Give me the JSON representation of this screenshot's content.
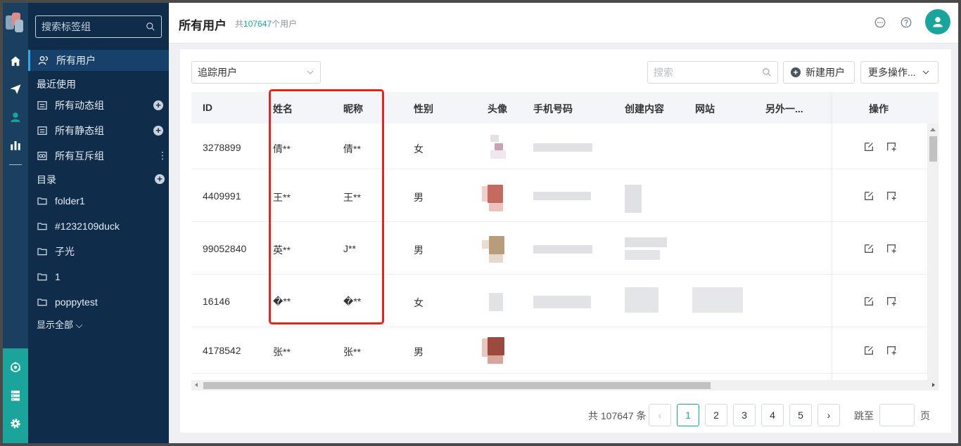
{
  "header": {
    "title": "所有用户",
    "count_prefix": "共",
    "count_value": "107647",
    "count_suffix": "个用户"
  },
  "sidebar": {
    "search_placeholder": "搜索标签组",
    "all_users": "所有用户",
    "recent_heading": "最近使用",
    "groups": [
      {
        "label": "所有动态组"
      },
      {
        "label": "所有静态组"
      },
      {
        "label": "所有互斥组"
      }
    ],
    "dir_heading": "目录",
    "folders": [
      {
        "label": "folder1"
      },
      {
        "label": "#1232109duck"
      },
      {
        "label": "子光"
      },
      {
        "label": "1"
      },
      {
        "label": "poppytest"
      }
    ],
    "show_all": "显示全部"
  },
  "toolbar": {
    "track_select": "追踪用户",
    "search_placeholder": "搜索",
    "new_user": "新建用户",
    "more_actions": "更多操作..."
  },
  "table": {
    "columns": [
      "ID",
      "姓名",
      "昵称",
      "性别",
      "头像",
      "手机号码",
      "创建内容",
      "网站",
      "另外一...",
      "操作"
    ],
    "rows": [
      {
        "id": "3278899",
        "name": "倩**",
        "nickname": "倩**",
        "gender": "女"
      },
      {
        "id": "4409991",
        "name": "王**",
        "nickname": "王**",
        "gender": "男"
      },
      {
        "id": "99052840",
        "name": "英**",
        "nickname": "J**",
        "gender": "男"
      },
      {
        "id": "16146",
        "name": "�**",
        "nickname": "�**",
        "gender": "女"
      },
      {
        "id": "4178542",
        "name": "张**",
        "nickname": "张**",
        "gender": "男"
      }
    ]
  },
  "pagination": {
    "total": "共 107647 条",
    "pages": [
      "1",
      "2",
      "3",
      "4",
      "5"
    ],
    "current": "1",
    "jump_label": "跳至",
    "page_label": "页"
  },
  "colors": {
    "accent": "#1aa49b",
    "sidebar_bg": "#0f2c4a",
    "rail_bg": "#1b3f5f",
    "highlight": "#e8231b"
  },
  "icons": [
    "home-icon",
    "send-icon",
    "user-icon",
    "bar-chart-icon",
    "network-icon",
    "database-icon",
    "gear-icon",
    "chat-icon",
    "help-icon",
    "search-icon",
    "plus-circle-icon",
    "edit-icon",
    "add-to-group-icon"
  ]
}
